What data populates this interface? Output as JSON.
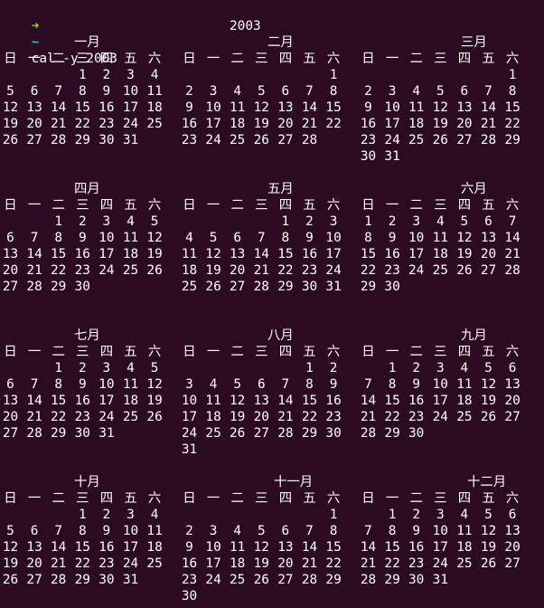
{
  "prompt": {
    "arrow": "➜",
    "cwd": "~",
    "command": "cal -y 2003"
  },
  "year": "2003",
  "weekdays": [
    "日",
    "一",
    "二",
    "三",
    "四",
    "五",
    "六"
  ],
  "months": [
    {
      "name": "一月",
      "start": 3,
      "days": 31
    },
    {
      "name": "二月",
      "start": 6,
      "days": 28
    },
    {
      "name": "三月",
      "start": 6,
      "days": 31
    },
    {
      "name": "四月",
      "start": 2,
      "days": 30
    },
    {
      "name": "五月",
      "start": 4,
      "days": 31
    },
    {
      "name": "六月",
      "start": 0,
      "days": 30
    },
    {
      "name": "七月",
      "start": 2,
      "days": 31
    },
    {
      "name": "八月",
      "start": 5,
      "days": 31
    },
    {
      "name": "九月",
      "start": 1,
      "days": 30
    },
    {
      "name": "十月",
      "start": 3,
      "days": 31
    },
    {
      "name": "十一月",
      "start": 6,
      "days": 30
    },
    {
      "name": "十二月",
      "start": 1,
      "days": 31
    }
  ]
}
